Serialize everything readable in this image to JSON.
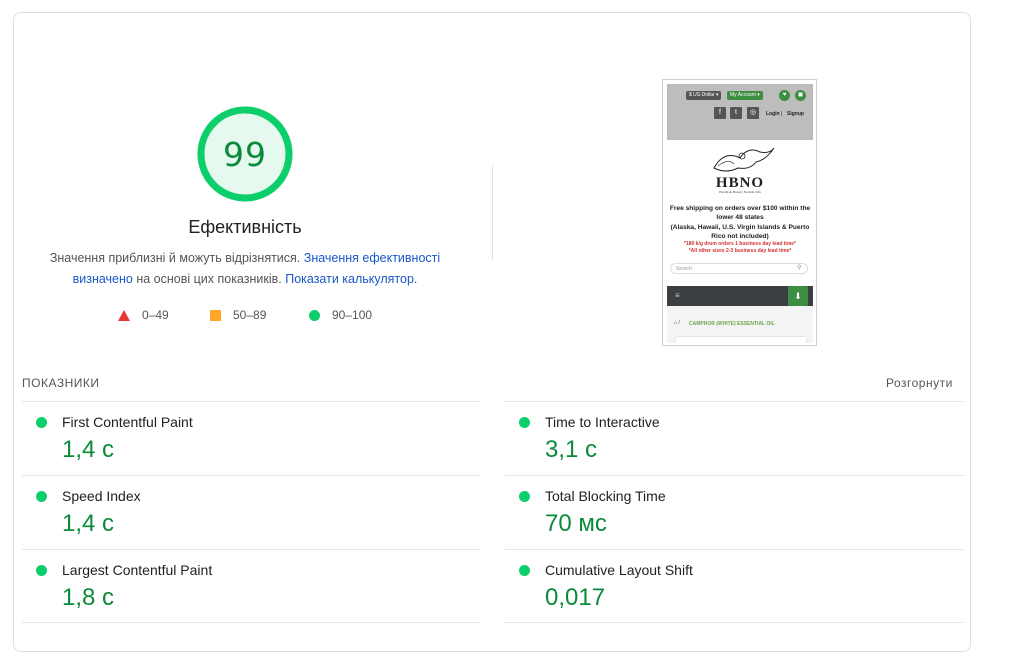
{
  "performance": {
    "score": "99",
    "score_fraction": 0.99,
    "title": "Ефективність",
    "desc_part1": "Значення приблизні й можуть відрізнятися. ",
    "desc_link1": "Значення ефективності визначено",
    "desc_part2": " на основі цих показників. ",
    "desc_link2": "Показати калькулятор",
    "desc_part3": ".",
    "colors": {
      "good": "#0cce6b",
      "average": "#ffa726",
      "poor": "#e53935",
      "link": "#1a57c9"
    }
  },
  "legend": [
    {
      "range": "0–49",
      "icon": "red-triangle-icon"
    },
    {
      "range": "50–89",
      "icon": "orange-square-icon"
    },
    {
      "range": "90–100",
      "icon": "green-circle-icon"
    }
  ],
  "screenshot": {
    "currency": "$ US Dollar ▾",
    "account": "My Account ▾",
    "login": "Login",
    "separator": "|",
    "signup": "Signup",
    "logo": "HBNO",
    "logo_sub": "Health & Beauty Natural Oils",
    "shipping_line1": "Free shipping on orders over $100 within the",
    "shipping_line2": "lower 48 states",
    "shipping_line3": "(Alaska, Hawaii, U.S. Virgin Islands & Puerto",
    "shipping_line4": "Rico not included)",
    "red_line1": "*180 k/g drum orders 1 business day lead time*",
    "red_line2": "*All other sizes 2-3 business day lead time*",
    "search_placeholder": "Search",
    "breadcrumb": "CAMPHOR (WHITE) ESSENTIAL OIL"
  },
  "metrics_section": {
    "label": "ПОКАЗНИКИ",
    "expand": "Розгорнути"
  },
  "metrics": [
    {
      "name": "First Contentful Paint",
      "value": "1,4 с"
    },
    {
      "name": "Time to Interactive",
      "value": "3,1 с"
    },
    {
      "name": "Speed Index",
      "value": "1,4 с"
    },
    {
      "name": "Total Blocking Time",
      "value": "70 мс"
    },
    {
      "name": "Largest Contentful Paint",
      "value": "1,8 с"
    },
    {
      "name": "Cumulative Layout Shift",
      "value": "0,017"
    }
  ]
}
